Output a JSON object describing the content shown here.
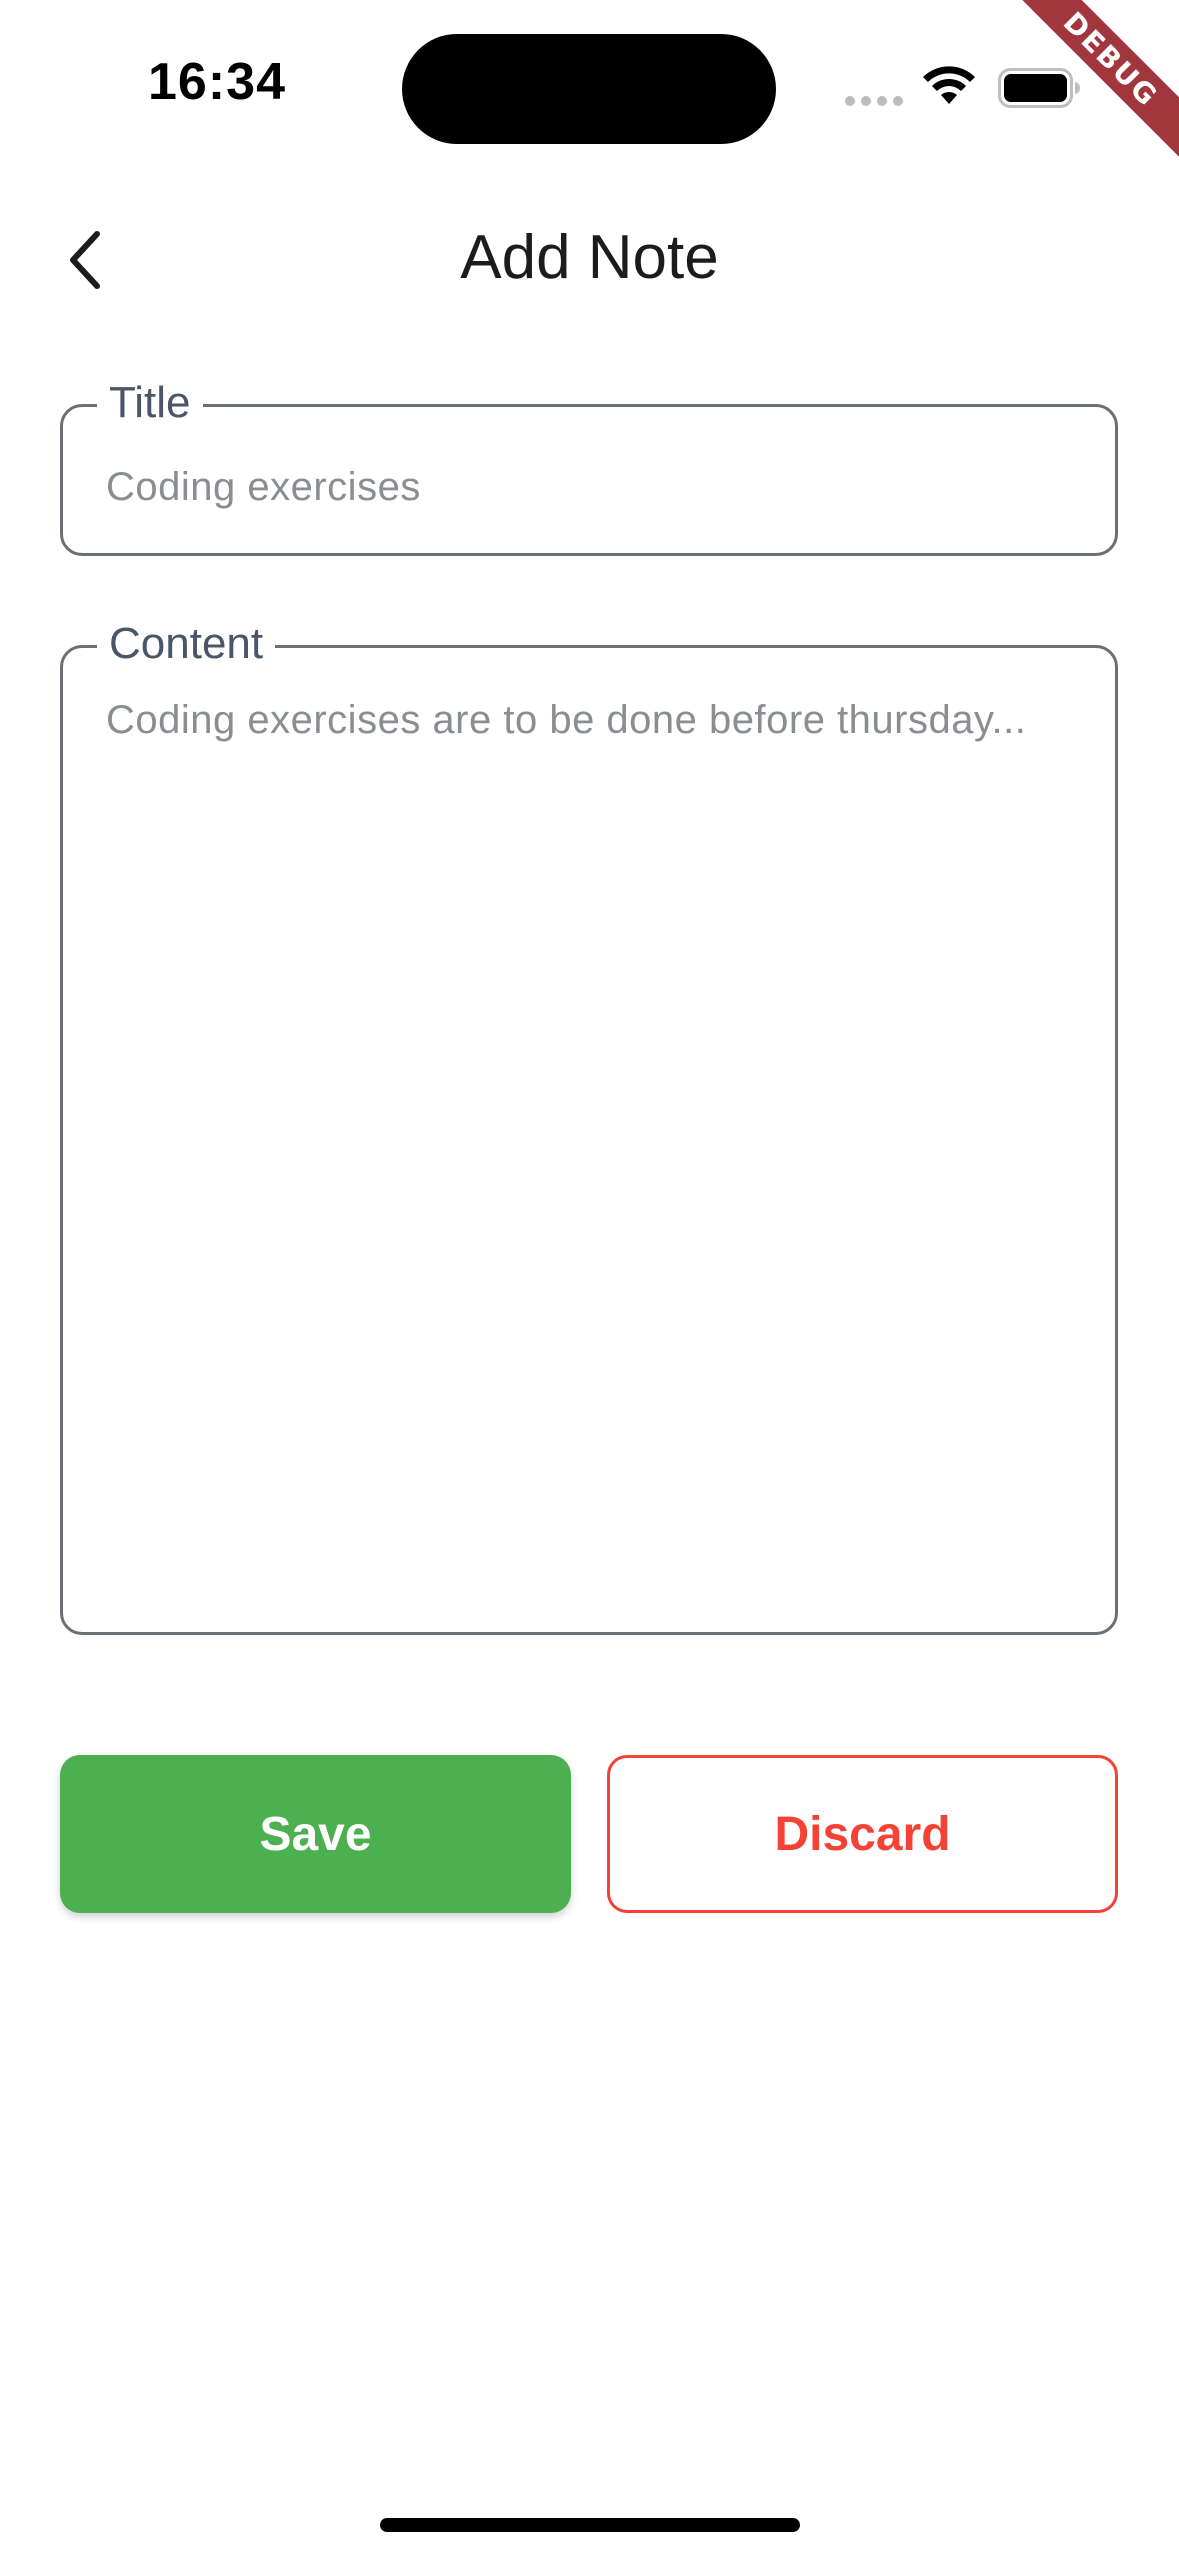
{
  "status_bar": {
    "time": "16:34",
    "wifi_icon": "wifi-icon",
    "battery_icon": "battery-icon",
    "signal_icon": "cellular-signal-icon"
  },
  "debug_banner": "DEBUG",
  "app_bar": {
    "back_icon": "chevron-left-icon",
    "title": "Add Note"
  },
  "form": {
    "title_field": {
      "label": "Title",
      "placeholder": "Coding exercises"
    },
    "content_field": {
      "label": "Content",
      "placeholder": "Coding exercises are to be done before thursday..."
    }
  },
  "actions": {
    "save_label": "Save",
    "discard_label": "Discard"
  },
  "colors": {
    "save": "#4caf50",
    "discard": "#f44336",
    "debug_banner": "#a1373d"
  }
}
